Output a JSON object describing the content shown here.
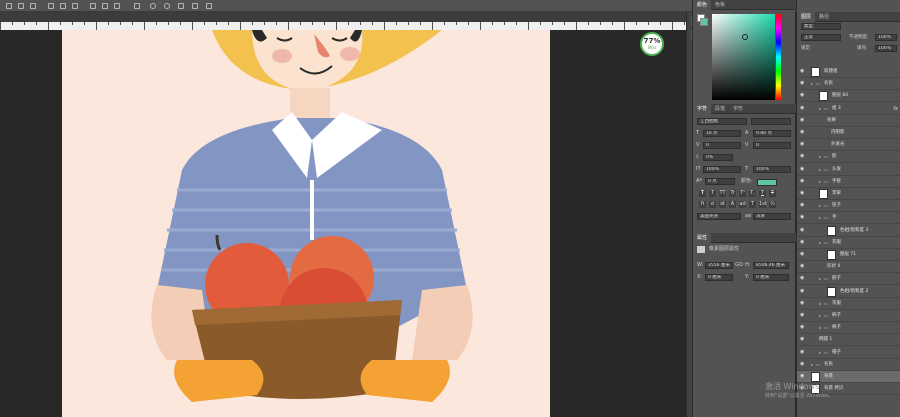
{
  "tabs": {
    "color": "颜色",
    "swatches": "色板",
    "layers": "图层",
    "paths": "路径",
    "character": "字符",
    "paragraph": "段落",
    "glyphs": "字形",
    "properties": "属性"
  },
  "zoom": {
    "percent": "77",
    "suffix": "%",
    "speed": "0K/s"
  },
  "layers_panel": {
    "filter_kind": "类型",
    "blend_mode": "正常",
    "opacity_label": "不透明度:",
    "opacity_value": "100%",
    "lock_label": "锁定:",
    "fill_label": "填充:",
    "fill_value": "100%",
    "items": [
      {
        "name": "新建组"
      },
      {
        "name": "农民"
      },
      {
        "name": "图层 84"
      },
      {
        "name": "组 3"
      },
      {
        "name": "效果"
      },
      {
        "name": "内阴影"
      },
      {
        "name": "外发光"
      },
      {
        "name": "脸"
      },
      {
        "name": "头发"
      },
      {
        "name": "手套"
      },
      {
        "name": "苹果"
      },
      {
        "name": "筐子"
      },
      {
        "name": "手"
      },
      {
        "name": "色相/饱和度 3"
      },
      {
        "name": "衣服"
      },
      {
        "name": "图层 71"
      },
      {
        "name": "形状 4"
      },
      {
        "name": "脖子"
      },
      {
        "name": "色相/饱和度 2"
      },
      {
        "name": "衣服"
      },
      {
        "name": "裤子"
      },
      {
        "name": "裤子"
      },
      {
        "name": "椭圆 1"
      },
      {
        "name": "帽子"
      },
      {
        "name": "农民"
      },
      {
        "name": "背景"
      },
      {
        "name": "背景 拷贝"
      }
    ]
  },
  "character_panel": {
    "font_family": "江西拙楷",
    "font_size": "16 点",
    "leading": "9.88 点",
    "kerning": "0",
    "tracking": "0",
    "scale_value": "0%",
    "vertical_scale": "100%",
    "horizontal_scale": "100%",
    "baseline_shift": "0 点",
    "color_label": "颜色:",
    "color_swatch": "#5ec8a6",
    "style_buttons": [
      "T",
      "T",
      "TT",
      "Tr",
      "T¹",
      "T,",
      "T",
      "T"
    ],
    "opentype_buttons": [
      "fi",
      "ơ",
      "st",
      "A",
      "ad",
      "T",
      "1st",
      "½"
    ],
    "language": "美国英语",
    "aa_icon": "aa",
    "antialias": "浑厚"
  },
  "properties_panel": {
    "title": "像素图层属性",
    "w_label": "W:",
    "w_value": "3556 厘米",
    "link_icon": "GO",
    "h_label": "H:",
    "h_value": "8506.46 厘米",
    "x_label": "X:",
    "x_value": "0 厘米",
    "y_label": "Y:",
    "y_value": "0 厘米"
  },
  "watermark": {
    "line1": "激活 Windows",
    "line2": "转到\"设置\"以激活 Windows。"
  }
}
